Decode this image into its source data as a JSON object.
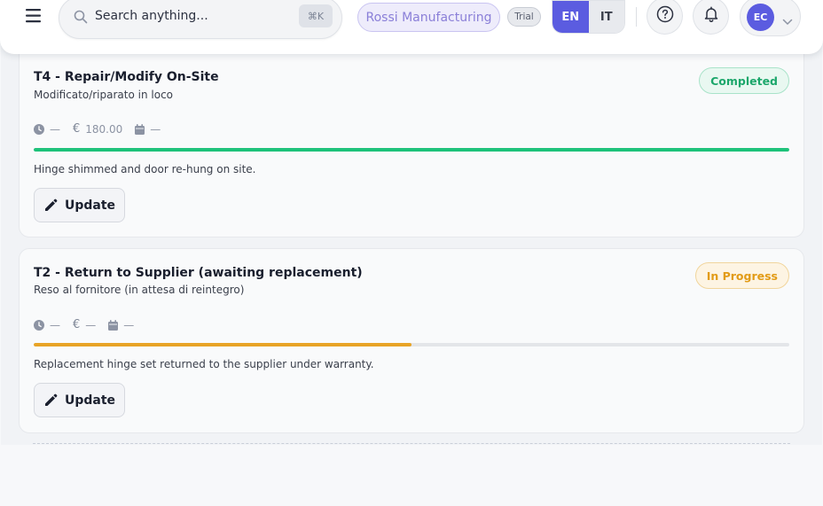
{
  "header": {
    "search_placeholder": "Search anything...",
    "search_shortcut": "⌘K",
    "organization": "Rossi Manufacturing",
    "plan_badge": "Trial",
    "languages": [
      {
        "code": "EN",
        "active": true
      },
      {
        "code": "IT",
        "active": false
      }
    ],
    "user_initials": "EC",
    "icons": {
      "menu": "menu-icon",
      "search": "search-icon",
      "help": "help-circle-icon",
      "notifications": "bell-icon",
      "account_dropdown": "chevron-down-icon"
    }
  },
  "tasks": [
    {
      "title": "T4 - Repair/Modify On-Site",
      "subtitle": "Modificato/riparato in loco",
      "status": "Completed",
      "status_color": "#1ca76b",
      "time": "—",
      "cost_symbol": "€",
      "cost": "180.00",
      "date": "—",
      "progress": 1.0,
      "progress_color": "#1ec27a",
      "note": "Hinge shimmed and door re-hung on site.",
      "action_label": "Update"
    },
    {
      "title": "T2 - Return to Supplier (awaiting replacement)",
      "subtitle": "Reso al fornitore (in attesa di reintegro)",
      "status": "In Progress",
      "status_color": "#e29b16",
      "time": "—",
      "cost_symbol": "€",
      "cost": "—",
      "date": "—",
      "progress": 0.5,
      "progress_color": "#e8a426",
      "note": "Replacement hinge set returned to the supplier under warranty.",
      "action_label": "Update"
    }
  ],
  "colors": {
    "accent": "#5b5ce0",
    "completed": "#1ca76b",
    "in_progress": "#e29b16"
  }
}
